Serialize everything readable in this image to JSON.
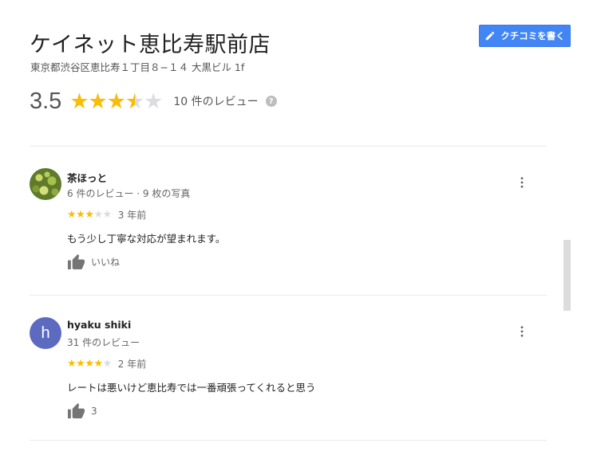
{
  "place": {
    "name": "ケイネット恵比寿駅前店",
    "address": "東京都渋谷区恵比寿１丁目８−１４ 大黒ビル 1f",
    "rating": "3.5",
    "rating_value": 3.5,
    "rating_max": 5,
    "review_count_label": "10 件のレビュー",
    "help_glyph": "?"
  },
  "actions": {
    "write_review_label": "クチコミを書く",
    "write_review_icon": "pencil-icon"
  },
  "colors": {
    "accent": "#4285f4",
    "star": "#fbbc04",
    "star_empty": "#dadce0",
    "avatar_letter_bg": "#5c6bc0"
  },
  "reviews": [
    {
      "name": "茶ほっと",
      "meta": "6 件のレビュー · 9 枚の写真",
      "stars": 3,
      "time": "3 年前",
      "text": "もう少し丁寧な対応が望まれます。",
      "like_label": "いいね",
      "avatar": "photo"
    },
    {
      "name": "hyaku shiki",
      "meta": "31 件のレビュー",
      "stars": 4,
      "time": "2 年前",
      "text": "レートは悪いけど恵比寿では一番頑張ってくれると思う",
      "like_label": "3",
      "avatar": "h"
    }
  ]
}
